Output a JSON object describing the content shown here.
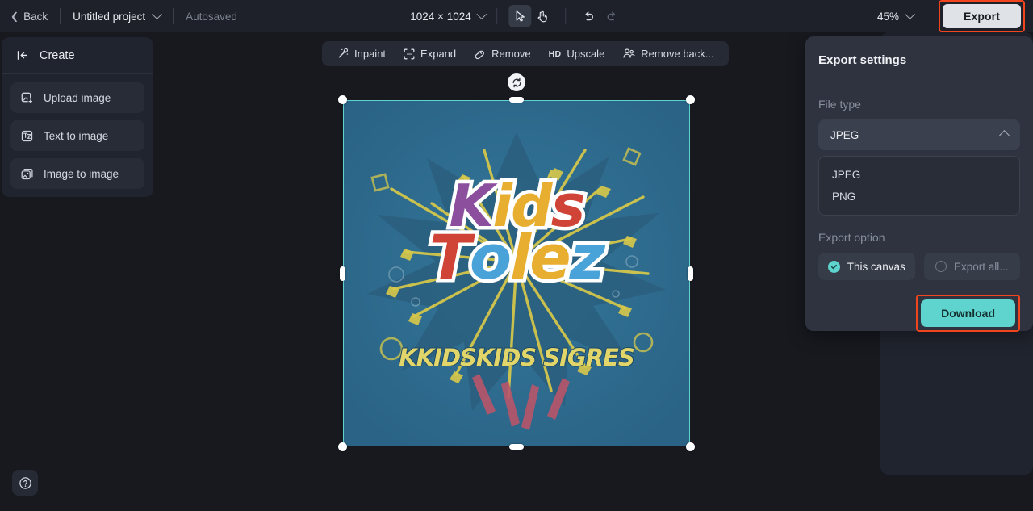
{
  "topbar": {
    "back_label": "Back",
    "project_name": "Untitled project",
    "autosaved_label": "Autosaved",
    "canvas_size": "1024 × 1024",
    "zoom_level": "45%",
    "export_label": "Export",
    "tools": [
      {
        "name": "select-tool",
        "icon": "cursor-arrow-icon",
        "active": true
      },
      {
        "name": "pan-tool",
        "icon": "hand-icon",
        "active": false
      },
      {
        "name": "undo-tool",
        "icon": "undo-arrow-icon",
        "active": false
      },
      {
        "name": "redo-tool",
        "icon": "redo-arrow-icon",
        "active": false
      }
    ],
    "highlight_color": "#f2441d"
  },
  "sidebar": {
    "header_label": "Create",
    "header_icon": "collapse-panel-icon",
    "items": [
      {
        "label": "Upload image",
        "icon": "upload-image-icon"
      },
      {
        "label": "Text to image",
        "icon": "text-to-image-icon"
      },
      {
        "label": "Image to image",
        "icon": "image-to-image-icon"
      }
    ]
  },
  "canvas_toolbar": {
    "items": [
      {
        "label": "Inpaint",
        "icon": "magic-wand-icon"
      },
      {
        "label": "Expand",
        "icon": "expand-frame-icon"
      },
      {
        "label": "Remove",
        "icon": "eraser-icon"
      },
      {
        "label": "Upscale",
        "icon": "hd-badge-icon",
        "badge": "HD"
      },
      {
        "label": "Remove back...",
        "icon": "remove-background-icon"
      }
    ]
  },
  "artboard": {
    "selected": true,
    "rotate_icon": "rotate-icon",
    "selection_color": "#5fd4cf",
    "artwork": {
      "background_color": "#2d6c90",
      "line1": [
        {
          "char": "K",
          "color": "#8b4f9e"
        },
        {
          "char": "i",
          "color": "#e8ae2f"
        },
        {
          "char": "d",
          "color": "#e8ae2f"
        },
        {
          "char": "s",
          "color": "#cf4436"
        }
      ],
      "line2": [
        {
          "char": "T",
          "color": "#cf4436"
        },
        {
          "char": "o",
          "color": "#4aa3d8"
        },
        {
          "char": "l",
          "color": "#e8ae2f"
        },
        {
          "char": "e",
          "color": "#e8ae2f"
        },
        {
          "char": "z",
          "color": "#4aa3d8"
        }
      ],
      "subtitle": "KKIDSKIDS SIGRES",
      "subtitle_color": "#e2d66a"
    }
  },
  "export_panel": {
    "title": "Export settings",
    "file_type_label": "File type",
    "file_type_value": "JPEG",
    "file_type_options": [
      "JPEG",
      "PNG"
    ],
    "export_option_label": "Export option",
    "options": [
      {
        "label": "This canvas",
        "selected": true
      },
      {
        "label": "Export all...",
        "selected": false
      }
    ],
    "download_label": "Download",
    "download_color": "#5fd4cf",
    "highlight_color": "#f2441d"
  },
  "help": {
    "icon": "question-mark-circle-icon"
  }
}
